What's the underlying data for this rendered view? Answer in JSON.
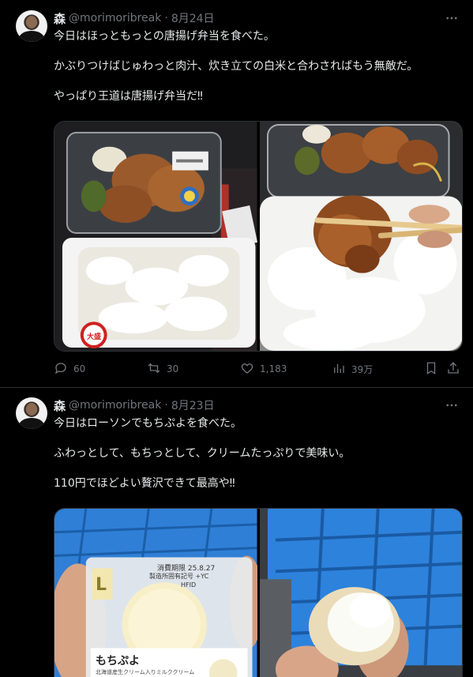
{
  "tweets": [
    {
      "name": "森",
      "handle": "@morimoribreak",
      "sep": "·",
      "date": "8月24日",
      "lines": [
        "今日はほっともっとの唐揚げ弁当を食べた。",
        "かぶりつけばじゅわっと肉汁、炊き立ての白米と合わさればもう無敵だ。",
        "やっぱり王道は唐揚げ弁当だ‼︎"
      ],
      "replies": "60",
      "retweets": "30",
      "likes": "1,183",
      "views": "39万"
    },
    {
      "name": "森",
      "handle": "@morimoribreak",
      "sep": "·",
      "date": "8月23日",
      "lines": [
        "今日はローソンでもちぷよを食べた。",
        "ふわっとして、もちっとして、クリームたっぷりで美味い。",
        "110円でほどよい贅沢できて最高や‼︎"
      ]
    }
  ],
  "media_text": {
    "sticker": "大盛",
    "mochi_title": "もちぷよ",
    "mochi_sub": "北海道産生クリーム入りミルククリーム",
    "mochi_l": "L",
    "mochi_date": "消費期限 25.8.27",
    "mochi_maker": "製造所固有記号 +YC",
    "mochi_hfid": "HFID"
  },
  "icons": {
    "more": "more-icon",
    "reply": "reply-icon",
    "retweet": "retweet-icon",
    "like": "heart-icon",
    "views": "views-icon",
    "bookmark": "bookmark-icon",
    "share": "share-icon"
  },
  "colors": {
    "bg": "#000000",
    "text": "#e7e9ea",
    "muted": "#71767b",
    "border": "#2f3336"
  }
}
